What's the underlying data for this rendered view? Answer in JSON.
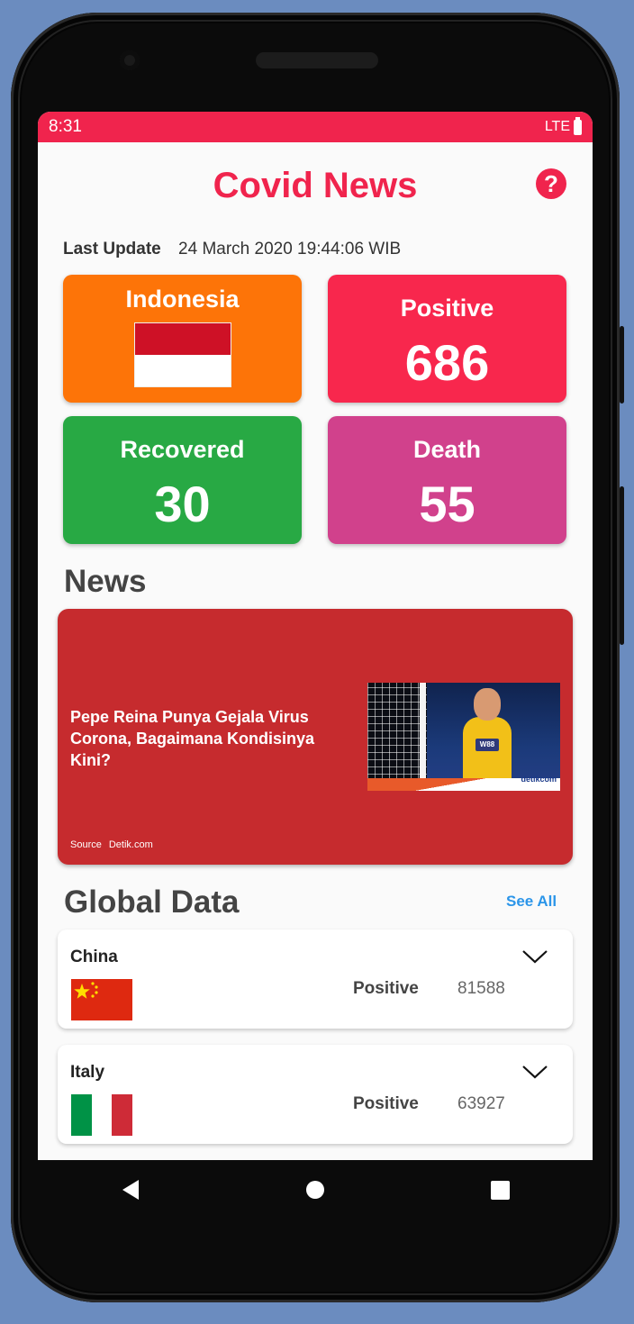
{
  "status_bar": {
    "time": "8:31",
    "network": "LTE"
  },
  "header": {
    "title": "Covid News",
    "help_icon": "question-circle-icon"
  },
  "last_update": {
    "label": "Last Update",
    "value": "24 March 2020 19:44:06 WIB"
  },
  "stats": {
    "country": {
      "label": "Indonesia",
      "flag": "indonesia-flag"
    },
    "positive": {
      "label": "Positive",
      "value": "686"
    },
    "recovered": {
      "label": "Recovered",
      "value": "30"
    },
    "death": {
      "label": "Death",
      "value": "55"
    }
  },
  "colors": {
    "accent": "#f0244d",
    "country_card": "#fd7408",
    "positive_card": "#f8274d",
    "recovered_card": "#28a944",
    "death_card": "#d1418c",
    "news_card": "#c62b2e",
    "link": "#2b95e9"
  },
  "news": {
    "section_title": "News",
    "headline": "Pepe Reina Punya Gejala Virus Corona, Bagaimana Kondisinya Kini?",
    "source_label": "Source",
    "source": "Detik.com",
    "image_logo_text": "detikcom",
    "image_jersey_text": "W88"
  },
  "global": {
    "section_title": "Global Data",
    "see_all": "See All",
    "countries": [
      {
        "name": "China",
        "positive_label": "Positive",
        "positive": "81588",
        "flag": "china-flag"
      },
      {
        "name": "Italy",
        "positive_label": "Positive",
        "positive": "63927",
        "flag": "italy-flag"
      }
    ]
  }
}
